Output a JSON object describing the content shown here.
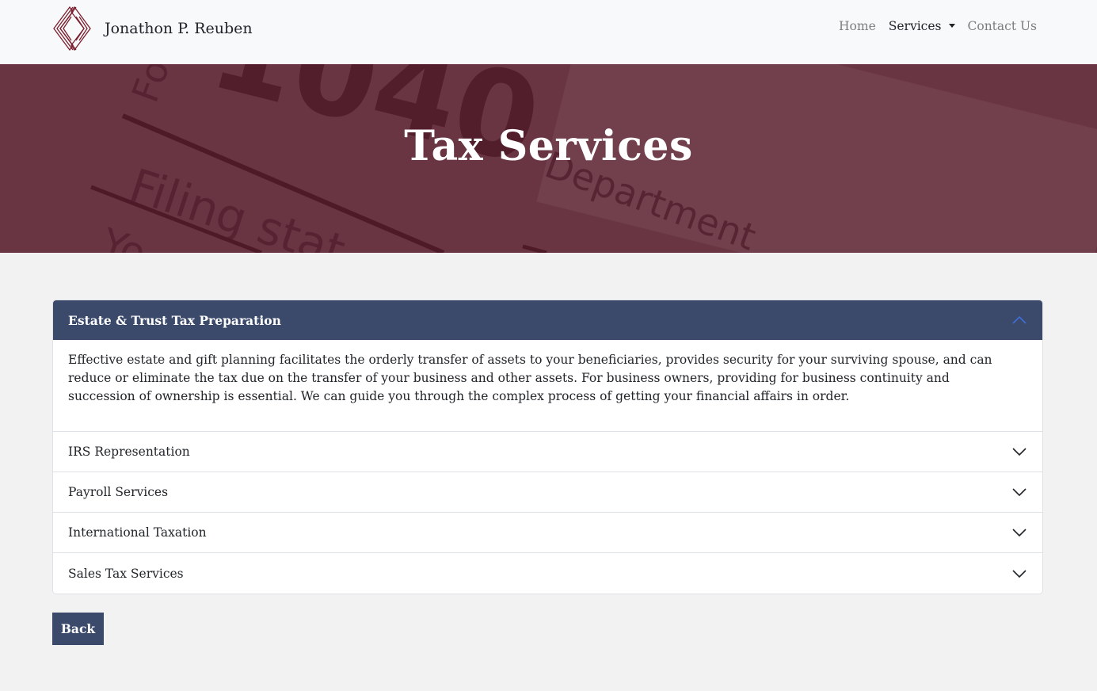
{
  "header": {
    "brand_name": "Jonathon P. Reuben",
    "nav": {
      "home": "Home",
      "services": "Services",
      "contact": "Contact Us"
    }
  },
  "hero": {
    "title": "Tax Services",
    "background_text": {
      "form_number": "1040",
      "filing_status": "Filing stat",
      "department": "Department",
      "fo": "Fo",
      "yo": "Yo"
    }
  },
  "accordion": {
    "open_item": {
      "title": "Estate & Trust Tax Preparation",
      "body": "Effective estate and gift planning facilitates the orderly transfer of assets to your beneficiaries, provides security for your surviving spouse, and can reduce or eliminate the tax due on the transfer of your business and other assets. For business owners, providing for business continuity and succession of ownership is essential. We can guide you through the complex process of getting your financial affairs in order."
    },
    "items": [
      {
        "title": "IRS Representation"
      },
      {
        "title": "Payroll Services"
      },
      {
        "title": "International Taxation"
      },
      {
        "title": "Sales Tax Services"
      }
    ]
  },
  "back_button": {
    "label": "Back"
  },
  "colors": {
    "accent": "#3b4a6b",
    "hero": "#6a3543",
    "logo": "#7a1f2e"
  }
}
